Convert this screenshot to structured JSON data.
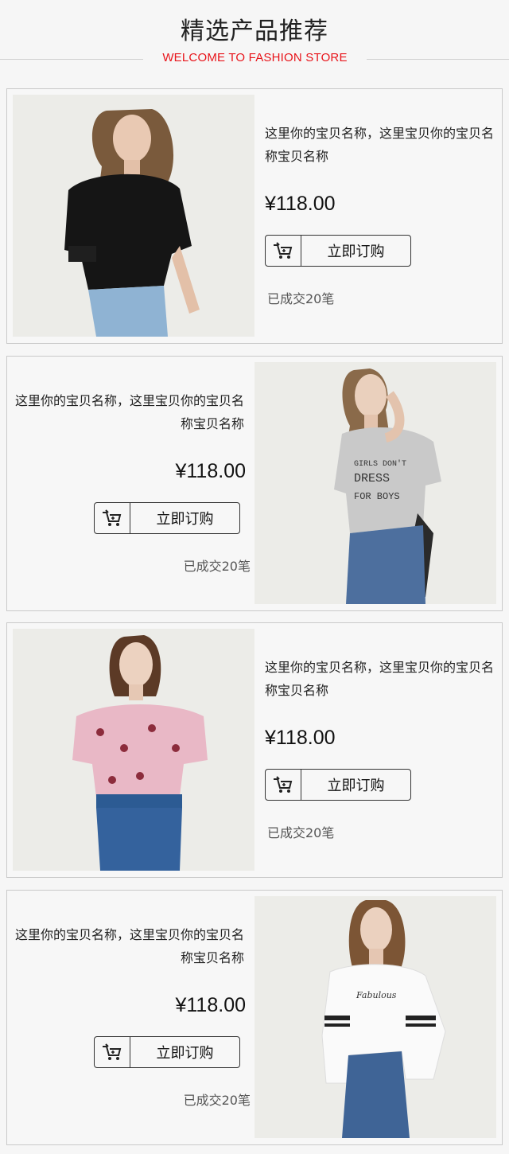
{
  "header": {
    "title": "精选产品推荐",
    "subtitle": "WELCOME TO FASHION STORE",
    "accent_color": "#e8141a"
  },
  "products": [
    {
      "image": "model-black-ruffle-top",
      "name": "这里你的宝贝名称，这里宝贝你的宝贝名称宝贝名称",
      "price": "¥118.00",
      "buy_label": "立即订购",
      "cart_icon": "cart-icon",
      "sold": "已成交20笔"
    },
    {
      "image": "model-grey-slogan-tee",
      "name": "这里你的宝贝名称，这里宝贝你的宝贝名称宝贝名称",
      "price": "¥118.00",
      "buy_label": "立即订购",
      "cart_icon": "cart-icon",
      "sold": "已成交20笔"
    },
    {
      "image": "model-pink-floral-top",
      "name": "这里你的宝贝名称，这里宝贝你的宝贝名称宝贝名称",
      "price": "¥118.00",
      "buy_label": "立即订购",
      "cart_icon": "cart-icon",
      "sold": "已成交20笔"
    },
    {
      "image": "model-white-bell-sleeve-tee",
      "name": "这里你的宝贝名称，这里宝贝你的宝贝名称宝贝名称",
      "price": "¥118.00",
      "buy_label": "立即订购",
      "cart_icon": "cart-icon",
      "sold": "已成交20笔"
    }
  ]
}
